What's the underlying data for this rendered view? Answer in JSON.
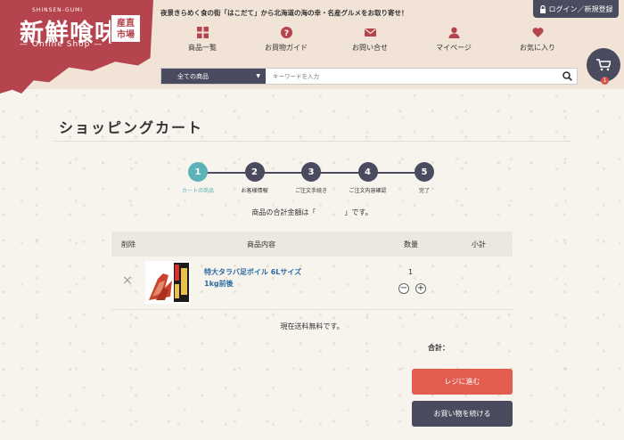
{
  "logo": {
    "sub": "SHINSEN-GUMI",
    "main": "新鮮喰味",
    "stamp_line1": "産直",
    "stamp_line2": "市場",
    "shop": "— Online Shop —"
  },
  "header": {
    "tagline": "夜景きらめく食の街「はこだて」から北海道の海の幸・名産グルメをお取り寄せ！",
    "login": "ログイン／新規登録"
  },
  "nav": [
    {
      "label": "商品一覧",
      "icon": "grid-icon"
    },
    {
      "label": "お買物ガイド",
      "icon": "question-icon"
    },
    {
      "label": "お問い合せ",
      "icon": "mail-icon"
    },
    {
      "label": "マイページ",
      "icon": "user-icon"
    },
    {
      "label": "お気に入り",
      "icon": "heart-icon"
    }
  ],
  "search": {
    "category": "全ての商品",
    "placeholder": "キーワードを入力"
  },
  "cart_badge": "1",
  "page_title": "ショッピングカート",
  "steps": [
    {
      "num": "1",
      "label": "カートの商品"
    },
    {
      "num": "2",
      "label": "お客様情報"
    },
    {
      "num": "3",
      "label": "ご注文手続き"
    },
    {
      "num": "4",
      "label": "ご注文内容確認"
    },
    {
      "num": "5",
      "label": "完了"
    }
  ],
  "total_message": "商品の合計金額は「　　　　」です。",
  "table": {
    "headers": {
      "delete": "削除",
      "content": "商品内容",
      "quantity": "数量",
      "subtotal": "小計"
    }
  },
  "item": {
    "name_line1": "特大タラバ足ボイル 6Lサイズ",
    "name_line2": "1kg前後",
    "quantity": "1",
    "delete": "×",
    "minus": "−",
    "plus": "+"
  },
  "shipping_message": "現在送料無料です。",
  "total_label": "合計：",
  "buttons": {
    "checkout": "レジに進む",
    "continue": "お買い物を続ける"
  },
  "colors": {
    "brand": "#b5444e",
    "dark": "#4a4b5e",
    "active_step": "#5bb3b8",
    "checkout": "#e25c4f"
  }
}
